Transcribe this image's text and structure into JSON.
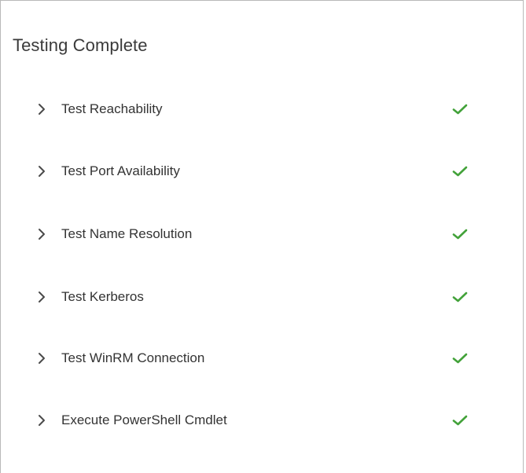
{
  "panel": {
    "title": "Testing Complete"
  },
  "tests": [
    {
      "label": "Test Reachability",
      "status": "passed"
    },
    {
      "label": "Test Port Availability",
      "status": "passed"
    },
    {
      "label": "Test Name Resolution",
      "status": "passed"
    },
    {
      "label": "Test Kerberos",
      "status": "passed"
    },
    {
      "label": "Test WinRM Connection",
      "status": "passed"
    },
    {
      "label": "Execute PowerShell Cmdlet",
      "status": "passed"
    }
  ],
  "icons": {
    "expand": "chevron-right-icon",
    "status": "checkmark-icon"
  },
  "colors": {
    "success": "#43a23a",
    "chevron": "#4a4a4a",
    "text": "#333333",
    "border": "#b9b9b9"
  }
}
